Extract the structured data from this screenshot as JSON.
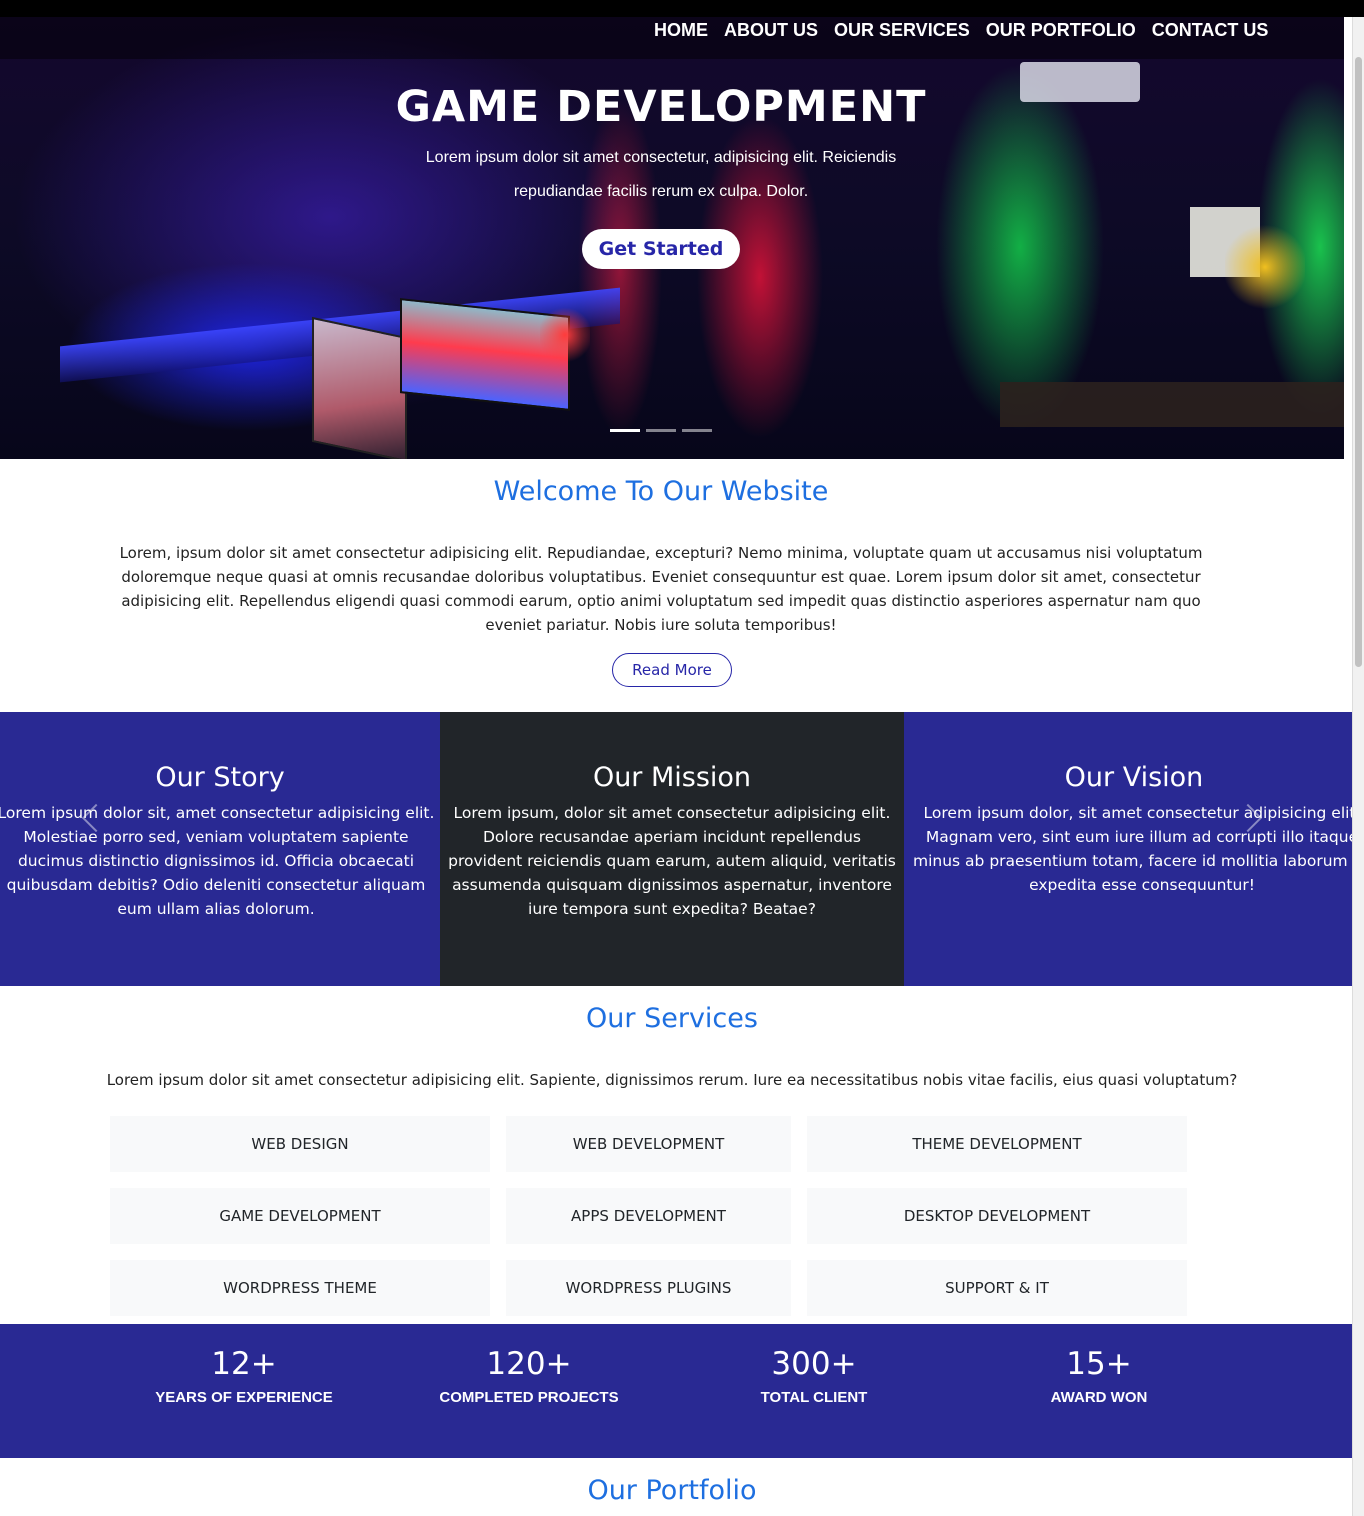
{
  "nav": {
    "items": [
      "HOME",
      "ABOUT US",
      "OUR SERVICES",
      "OUR PORTFOLIO",
      "CONTACT US"
    ]
  },
  "hero": {
    "title": "GAME DEVELOPMENT",
    "text": "Lorem ipsum dolor sit amet consectetur, adipisicing elit. Reiciendis repudiandae facilis rerum ex culpa. Dolor.",
    "button": "Get Started",
    "slides_total": 3,
    "active_slide": 1
  },
  "welcome": {
    "title": "Welcome To Our Website",
    "text": "Lorem, ipsum dolor sit amet consectetur adipisicing elit. Repudiandae, excepturi? Nemo minima, voluptate quam ut accusamus nisi voluptatum doloremque neque quasi at omnis recusandae doloribus voluptatibus. Eveniet consequuntur est quae. Lorem ipsum dolor sit amet, consectetur adipisicing elit. Repellendus eligendi quasi commodi earum, optio animi voluptatum sed impedit quas distinctio asperiores aspernatur nam quo eveniet pariatur. Nobis iure soluta temporibus!",
    "button": "Read More"
  },
  "about": {
    "story": {
      "title": "Our Story",
      "text": "Lorem ipsum dolor sit, amet consectetur adipisicing elit. Molestiae porro sed, veniam voluptatem sapiente ducimus distinctio dignissimos id. Officia obcaecati quibusdam debitis? Odio deleniti consectetur aliquam eum ullam alias dolorum."
    },
    "mission": {
      "title": "Our Mission",
      "text": "Lorem ipsum, dolor sit amet consectetur adipisicing elit. Dolore recusandae aperiam incidunt repellendus provident reiciendis quam earum, autem aliquid, veritatis assumenda quisquam dignissimos aspernatur, inventore iure tempora sunt expedita? Beatae?"
    },
    "vision": {
      "title": "Our Vision",
      "text": "Lorem ipsum dolor, sit amet consectetur adipisicing elit. Magnam vero, sint eum iure illum ad corrupti illo itaque minus ab praesentium totam, facere id mollitia laborum ex expedita esse consequuntur!"
    }
  },
  "services": {
    "title": "Our Services",
    "text": "Lorem ipsum dolor sit amet consectetur adipisicing elit. Sapiente, dignissimos rerum. Iure ea necessitatibus nobis vitae facilis, eius quasi voluptatum?",
    "items": [
      "WEB DESIGN",
      "WEB DEVELOPMENT",
      "THEME DEVELOPMENT",
      "GAME DEVELOPMENT",
      "APPS DEVELOPMENT",
      "DESKTOP DEVELOPMENT",
      "WORDPRESS THEME",
      "WORDPRESS PLUGINS",
      "SUPPORT & IT"
    ]
  },
  "stats": [
    {
      "value": "12+",
      "label": "YEARS OF EXPERIENCE"
    },
    {
      "value": "120+",
      "label": "COMPLETED PROJECTS"
    },
    {
      "value": "300+",
      "label": "TOTAL CLIENT"
    },
    {
      "value": "15+",
      "label": "AWARD WON"
    }
  ],
  "portfolio": {
    "title": "Our Portfolio"
  },
  "colors": {
    "accent_blue": "#1e6fe0",
    "panel_indigo": "#292993",
    "panel_dark": "#212529",
    "button_text": "#2726a8"
  },
  "icons": {
    "carousel_prev": "chevron-left-icon",
    "carousel_next": "chevron-right-icon"
  }
}
